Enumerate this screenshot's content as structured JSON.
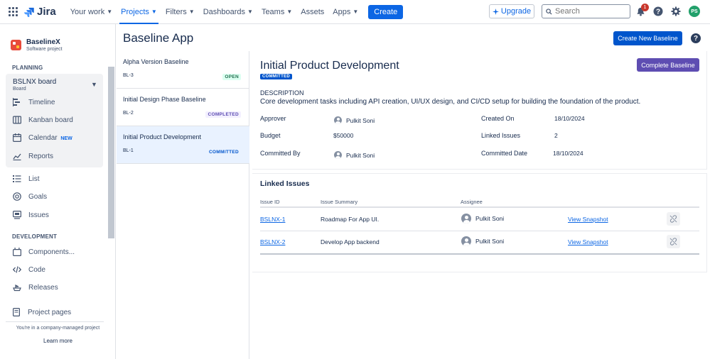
{
  "topnav": {
    "logo_text": "Jira",
    "items": [
      {
        "label": "Your work",
        "active": false
      },
      {
        "label": "Projects",
        "active": true
      },
      {
        "label": "Filters",
        "active": false
      },
      {
        "label": "Dashboards",
        "active": false
      },
      {
        "label": "Teams",
        "active": false
      },
      {
        "label": "Assets",
        "active": false
      },
      {
        "label": "Apps",
        "active": false
      }
    ],
    "create_label": "Create",
    "upgrade_label": "Upgrade",
    "search_placeholder": "Search",
    "notification_count": "1",
    "avatar_initials": "PS",
    "icons": [
      "app-switcher-icon",
      "jira-logo-icon",
      "sparkle-icon",
      "search-icon",
      "bell-icon",
      "help-icon",
      "gear-icon"
    ]
  },
  "sidebar": {
    "project_name": "BaselineX",
    "project_type": "Software project",
    "planning_label": "PLANNING",
    "board_name": "BSLNX board",
    "board_sub": "Board",
    "planning_items": [
      {
        "label": "Timeline",
        "icon": "timeline-icon"
      },
      {
        "label": "Kanban board",
        "icon": "board-icon"
      },
      {
        "label": "Calendar",
        "icon": "calendar-icon",
        "tag": "NEW"
      },
      {
        "label": "Reports",
        "icon": "reports-icon"
      }
    ],
    "other_items": [
      {
        "label": "List",
        "icon": "list-icon"
      },
      {
        "label": "Goals",
        "icon": "goals-icon"
      },
      {
        "label": "Issues",
        "icon": "issues-icon"
      }
    ],
    "development_label": "DEVELOPMENT",
    "development_items": [
      {
        "label": "Components...",
        "icon": "components-icon"
      },
      {
        "label": "Code",
        "icon": "code-icon"
      },
      {
        "label": "Releases",
        "icon": "releases-icon"
      }
    ],
    "project_pages_label": "Project pages",
    "footer_text": "You're in a company-managed project",
    "learn_more": "Learn more"
  },
  "main": {
    "page_title": "Baseline App",
    "create_new_label": "Create New Baseline",
    "baselines": [
      {
        "name": "Alpha Version Baseline",
        "id": "BL-3",
        "status": "OPEN"
      },
      {
        "name": "Initial Design Phase Baseline",
        "id": "BL-2",
        "status": "COMPLETED"
      },
      {
        "name": "Initial Product Development",
        "id": "BL-1",
        "status": "COMMITTED",
        "selected": true
      }
    ],
    "detail": {
      "title": "Initial Product Development",
      "status": "COMMITTED",
      "complete_label": "Complete Baseline",
      "description_label": "DESCRIPTION",
      "description": "Core development tasks including API creation, UI/UX design, and CI/CD setup for building the foundation of the product.",
      "approver_label": "Approver",
      "approver": "Pulkit Soni",
      "budget_label": "Budget",
      "budget": "$50000",
      "committed_by_label": "Committed By",
      "committed_by": "Pulkit Soni",
      "created_on_label": "Created On",
      "created_on": "18/10/2024",
      "linked_issues_label": "Linked Issues",
      "linked_issues_count": "2",
      "committed_date_label": "Committed Date",
      "committed_date": "18/10/2024"
    },
    "linked_issues": {
      "title": "Linked Issues",
      "headers": {
        "id": "Issue ID",
        "summary": "Issue Summary",
        "assignee": "Assignee"
      },
      "rows": [
        {
          "id": "BSLNX-1",
          "summary": "Roadmap For App UI.",
          "assignee": "Pulkit Soni",
          "snapshot": "View Snapshot"
        },
        {
          "id": "BSLNX-2",
          "summary": "Develop App backend",
          "assignee": "Pulkit Soni",
          "snapshot": "View Snapshot"
        }
      ]
    }
  },
  "colors": {
    "primary": "#0c66e4",
    "purple": "#5e4db2",
    "brand_blue": "#0055cc"
  }
}
